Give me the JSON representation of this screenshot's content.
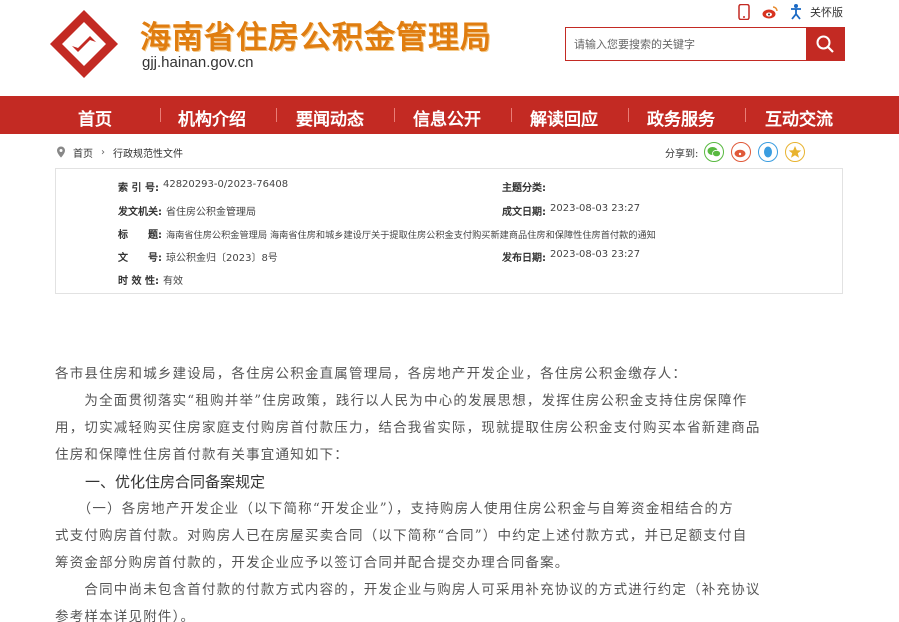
{
  "header": {
    "site_title": "海南省住房公积金管理局",
    "site_domain": "gjj.hainan.gov.cn",
    "care_label": "关怀版",
    "icons": [
      "mobile-icon",
      "weibo-icon",
      "accessibility-icon"
    ],
    "brand_color": "#c32a23",
    "title_color": "#e07d10"
  },
  "search": {
    "placeholder": "请输入您要搜索的关键字"
  },
  "nav": {
    "items": [
      "首页",
      "机构介绍",
      "要闻动态",
      "信息公开",
      "解读回应",
      "政务服务",
      "互动交流"
    ]
  },
  "breadcrumb": {
    "home": "首页",
    "current": "行政规范性文件",
    "share_label": "分享到:"
  },
  "meta": {
    "index_label": "索 引 号:",
    "index_value": "42820293-0/2023-76408",
    "topic_label": "主题分类:",
    "topic_value": "",
    "issuer_label": "发文机关:",
    "issuer_value": "省住房公积金管理局",
    "created_label": "成文日期:",
    "created_value": "2023-08-03 23:27",
    "title_label": "标　　题:",
    "title_value": "海南省住房公积金管理局 海南省住房和城乡建设厅关于提取住房公积金支付购买新建商品住房和保障性住房首付款的通知",
    "docno_label": "文　　号:",
    "docno_value": "琼公积金归〔2023〕8号",
    "published_label": "发布日期:",
    "published_value": "2023-08-03 23:27",
    "validity_label": "时 效 性:",
    "validity_value": "有效"
  },
  "article": {
    "salutation": "各市县住房和城乡建设局，各住房公积金直属管理局，各房地产开发企业，各住房公积金缴存人：",
    "intro_line1": "　　为全面贯彻落实“租购并举”住房政策，践行以人民为中心的发展思想，发挥住房公积金支持住房保障作",
    "intro_line2": "用，切实减轻购买住房家庭支付购房首付款压力，结合我省实际，现就提取住房公积金支付购买本省新建商品",
    "intro_line3": "住房和保障性住房首付款有关事宜通知如下：",
    "section1": "　　一、优化住房合同备案规定",
    "p1_line1": "　　（一）各房地产开发企业（以下简称“开发企业”），支持购房人使用住房公积金与自筹资金相结合的方",
    "p1_line2": "式支付购房首付款。对购房人已在房屋买卖合同（以下简称“合同”）中约定上述付款方式，并已足额支付自",
    "p1_line3": "筹资金部分购房首付款的，开发企业应予以签订合同并配合提交办理合同备案。",
    "p2_line1": "　　合同中尚未包含首付款的付款方式内容的，开发企业与购房人可采用补充协议的方式进行约定（补充协议",
    "p2_line2": "参考样本详见附件）。"
  }
}
